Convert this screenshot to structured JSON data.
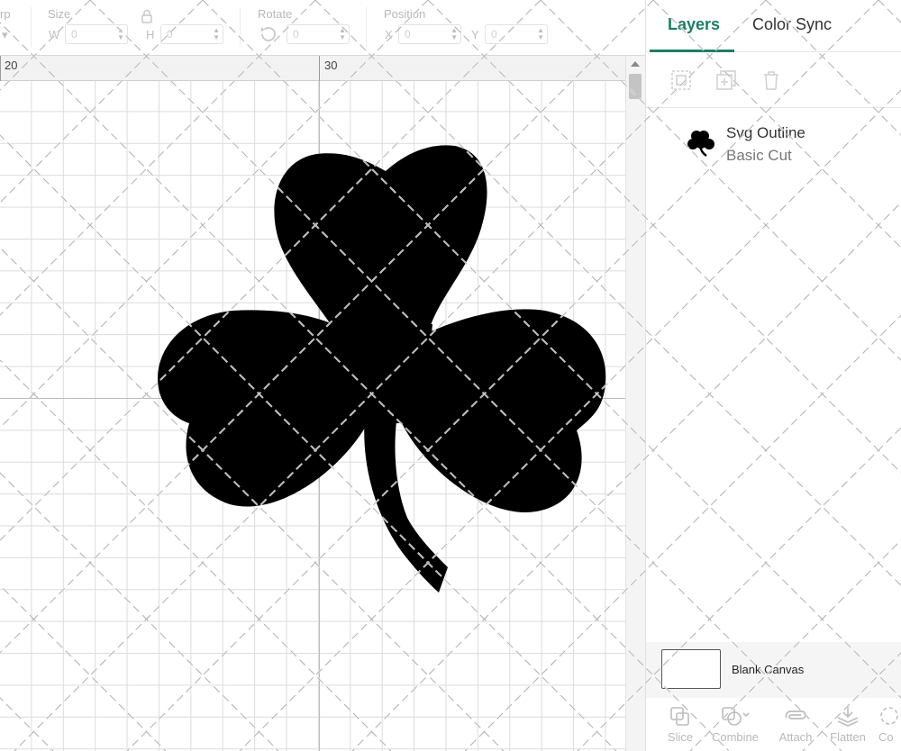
{
  "toolbar": {
    "arrange_fragment": "rp",
    "size_label": "Size",
    "width_prefix": "W",
    "width_value": "0",
    "height_prefix": "H",
    "height_value": "0",
    "rotate_label": "Rotate",
    "rotate_value": "0",
    "position_label": "Position",
    "x_prefix": "X",
    "x_value": "0",
    "y_prefix": "Y",
    "y_value": "0"
  },
  "ruler": {
    "marks": [
      "20",
      "30"
    ]
  },
  "panel": {
    "tabs": [
      {
        "label": "Layers",
        "active": true
      },
      {
        "label": "Color Sync",
        "active": false
      }
    ],
    "layer": {
      "name": "Svg Outline",
      "operation": "Basic Cut",
      "icon": "shamrock-icon"
    },
    "blank_canvas_label": "Blank Canvas",
    "bottom_tools": [
      {
        "label": "Slice",
        "icon": "slice-icon"
      },
      {
        "label": "Combine",
        "icon": "combine-icon"
      },
      {
        "label": "Attach",
        "icon": "attach-icon"
      },
      {
        "label": "Flatten",
        "icon": "flatten-icon"
      },
      {
        "label": "Co",
        "icon": "contour-icon"
      }
    ]
  },
  "colors": {
    "accent": "#1a7f64",
    "shape_fill": "#000000",
    "grid": "#dcdcdc"
  }
}
